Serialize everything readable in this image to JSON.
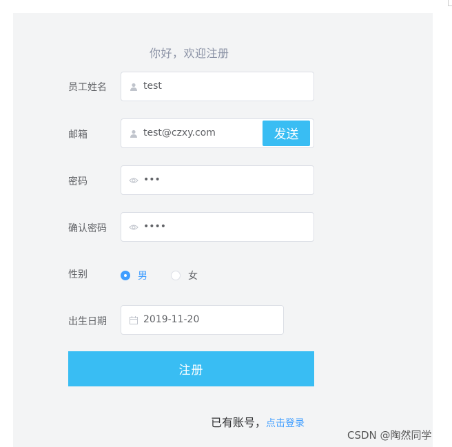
{
  "form": {
    "title": "你好，欢迎注册",
    "name": {
      "label": "员工姓名",
      "value": "test",
      "icon": "user-icon"
    },
    "email": {
      "label": "邮箱",
      "value": "test@czxy.com",
      "icon": "user-icon",
      "send_label": "发送"
    },
    "password": {
      "label": "密码",
      "value": "•••",
      "icon": "eye-icon"
    },
    "confirm_password": {
      "label": "确认密码",
      "value": "••••",
      "icon": "eye-icon"
    },
    "gender": {
      "label": "性别",
      "options": [
        {
          "label": "男",
          "selected": true
        },
        {
          "label": "女",
          "selected": false
        }
      ]
    },
    "birthday": {
      "label": "出生日期",
      "value": "2019-11-20",
      "icon": "calendar-icon"
    },
    "submit_label": "注册"
  },
  "footer": {
    "prompt": "已有账号，",
    "login_link": "点击登录"
  },
  "watermark": "CSDN @陶然同学",
  "colors": {
    "accent": "#39bdf3",
    "link": "#409eff",
    "panel_bg": "#f3f4f5"
  }
}
